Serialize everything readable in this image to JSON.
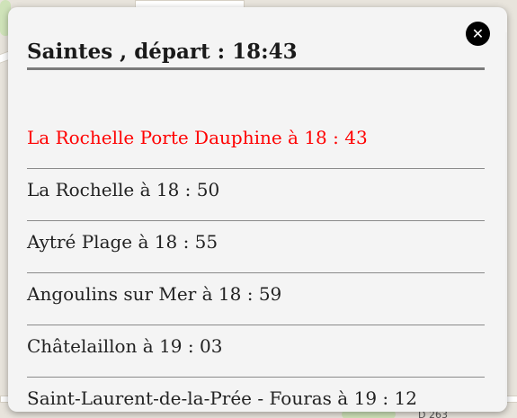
{
  "popup": {
    "title": "Saintes , départ : 18:43",
    "close_symbol": "✕",
    "stops": [
      {
        "name": "La Rochelle Porte Dauphine",
        "joiner": " à ",
        "time": "18 : 43",
        "current": true
      },
      {
        "name": "La Rochelle",
        "joiner": " à ",
        "time": "18 : 50",
        "current": false
      },
      {
        "name": "Aytré Plage",
        "joiner": " à ",
        "time": "18 : 55",
        "current": false
      },
      {
        "name": "Angoulins sur Mer",
        "joiner": " à ",
        "time": "18 : 59",
        "current": false
      },
      {
        "name": "Châtelaillon",
        "joiner": " à ",
        "time": "19 : 03",
        "current": false
      },
      {
        "name": "Saint-Laurent-de-la-Prée - Fouras",
        "joiner": " à ",
        "time": "19 : 12",
        "current": false
      }
    ]
  },
  "map": {
    "road_label": "D 263"
  },
  "colors": {
    "current_stop": "#ff0000",
    "popup_bg": "#f4f4f4",
    "divider": "#8a8a8a"
  },
  "icons": {
    "close": "close-icon",
    "scroll_down": "scroll-down-arrow-icon"
  }
}
